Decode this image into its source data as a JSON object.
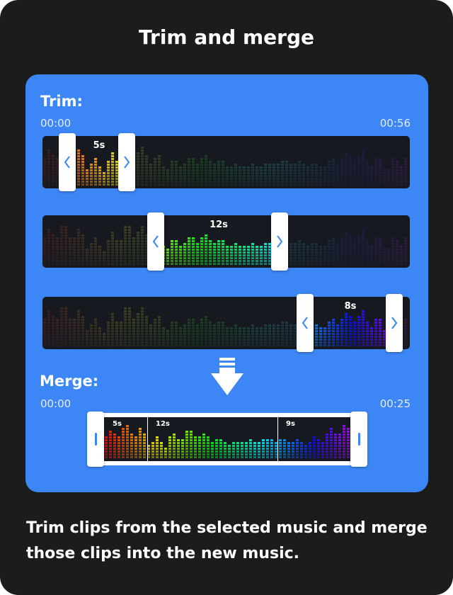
{
  "title": "Trim and merge",
  "trim": {
    "label": "Trim:",
    "start_time": "00:00",
    "end_time": "00:56",
    "clips": [
      {
        "length_label": "5s",
        "start_fraction": 0.09,
        "end_fraction": 0.23
      },
      {
        "length_label": "12s",
        "start_fraction": 0.32,
        "end_fraction": 0.64
      },
      {
        "length_label": "8s",
        "start_fraction": 0.73,
        "end_fraction": 0.96
      }
    ]
  },
  "merge": {
    "label": "Merge:",
    "start_time": "00:00",
    "end_time": "00:25",
    "segments": [
      {
        "label": "5s",
        "seconds": 5
      },
      {
        "label": "12s",
        "seconds": 12
      },
      {
        "label": "9s",
        "seconds": 9
      }
    ]
  },
  "description": "Trim clips from the selected music and merge those clips into the new music.",
  "colors": {
    "card_bg": "#1c1c1c",
    "panel_bg": "#3d86f6",
    "handle_bg": "#ffffff",
    "handle_arrow": "#3d86f6"
  },
  "icons": {
    "handle_left": "chevron-left-icon",
    "handle_right": "chevron-right-icon",
    "merge_arrow": "down-arrow-icon",
    "merge_grip": "grip-bar-icon"
  }
}
